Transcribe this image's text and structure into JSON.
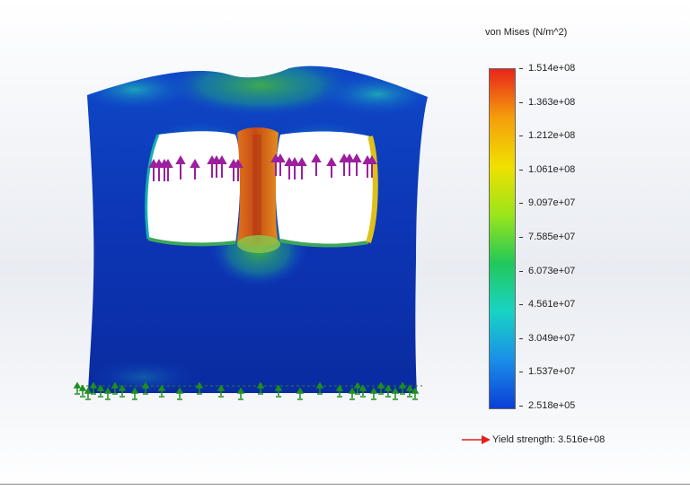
{
  "legend": {
    "title": "von Mises (N/m^2)",
    "colors": [
      "#e8251c",
      "#f59e0b",
      "#f0e000",
      "#9be51a",
      "#22c85a",
      "#18d4c4",
      "#1a8fe8",
      "#0b3fd6"
    ],
    "ticks": [
      "1.514e+08",
      "1.363e+08",
      "1.212e+08",
      "1.061e+08",
      "9.097e+07",
      "7.585e+07",
      "6.073e+07",
      "4.561e+07",
      "3.049e+07",
      "1.537e+07",
      "2.518e+05"
    ]
  },
  "yield": {
    "text": "Yield strength: 3.516e+08",
    "arrow_color": "#e02020"
  },
  "model": {
    "load_arrow_color": "#9b1f9e",
    "fixture_color": "#1f8f1f"
  }
}
